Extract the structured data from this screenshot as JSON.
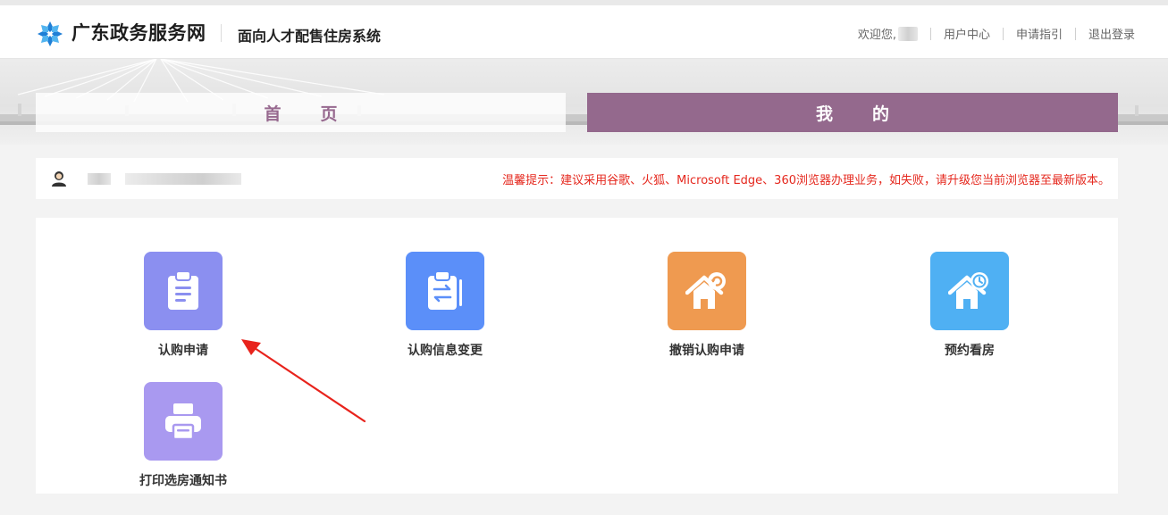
{
  "header": {
    "site_name": "广东政务服务网",
    "system_name": "面向人才配售住房系统",
    "welcome": "欢迎您,",
    "links": [
      "用户中心",
      "申请指引",
      "退出登录"
    ]
  },
  "tabs": {
    "home": "首页",
    "mine": "我的"
  },
  "notice": "温馨提示：建议采用谷歌、火狐、Microsoft Edge、360浏览器办理业务，如失败，请升级您当前浏览器至最新版本。",
  "functions": [
    {
      "label": "认购申请",
      "icon": "clipboard-doc-icon",
      "color": "#8b8ff0"
    },
    {
      "label": "认购信息变更",
      "icon": "clipboard-swap-icon",
      "color": "#5b8ff9"
    },
    {
      "label": "撤销认购申请",
      "icon": "house-undo-icon",
      "color": "#ef9a50"
    },
    {
      "label": "预约看房",
      "icon": "house-clock-icon",
      "color": "#4fb0f3"
    },
    {
      "label": "打印选房通知书",
      "icon": "printer-icon",
      "color": "#a999f0"
    }
  ],
  "colors": {
    "tab_active": "#94698d",
    "tab_text": "#97698f",
    "notice": "#e5281e",
    "arrow": "#e8231c"
  }
}
